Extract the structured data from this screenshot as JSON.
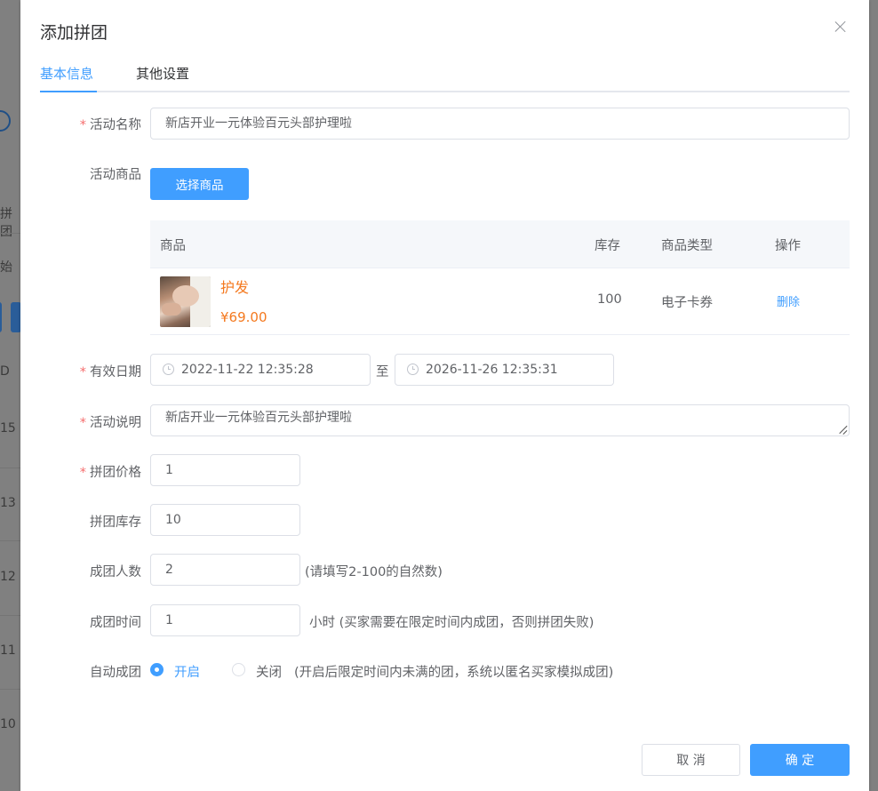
{
  "background": {
    "left_fragments": [
      "拼团",
      "始",
      "D",
      "15",
      "13",
      "12",
      "11",
      "10"
    ]
  },
  "dialog": {
    "title": "添加拼团",
    "tabs": [
      {
        "label": "基本信息",
        "active": true
      },
      {
        "label": "其他设置",
        "active": false
      }
    ]
  },
  "form": {
    "activity_name": {
      "label": "活动名称",
      "required": true,
      "value": "新店开业一元体验百元头部护理啦"
    },
    "activity_goods": {
      "label": "活动商品",
      "button": "选择商品"
    },
    "goods_table": {
      "headers": [
        "商品",
        "库存",
        "商品类型",
        "操作"
      ],
      "rows": [
        {
          "name": "护发",
          "price": "¥69.00",
          "stock": "100",
          "type": "电子卡券",
          "action": "删除"
        }
      ]
    },
    "valid_date": {
      "label": "有效日期",
      "required": true,
      "start": "2022-11-22 12:35:28",
      "separator": "至",
      "end": "2026-11-26 12:35:31"
    },
    "description": {
      "label": "活动说明",
      "required": true,
      "value": "新店开业一元体验百元头部护理啦"
    },
    "group_price": {
      "label": "拼团价格",
      "required": true,
      "value": "1"
    },
    "group_stock": {
      "label": "拼团库存",
      "value": "10"
    },
    "group_size": {
      "label": "成团人数",
      "value": "2",
      "hint": "(请填写2-100的自然数)"
    },
    "group_time": {
      "label": "成团时间",
      "value": "1",
      "hint": "小时 (买家需要在限定时间内成团，否则拼团失败)"
    },
    "auto_group": {
      "label": "自动成团",
      "options": [
        {
          "label": "开启",
          "checked": true
        },
        {
          "label": "关闭",
          "checked": false
        }
      ],
      "hint": "(开启后限定时间内未满的团，系统以匿名买家模拟成团)"
    }
  },
  "footer": {
    "cancel": "取 消",
    "confirm": "确 定"
  },
  "colors": {
    "primary": "#409eff",
    "price": "#f4791f",
    "required": "#f56c6c"
  }
}
